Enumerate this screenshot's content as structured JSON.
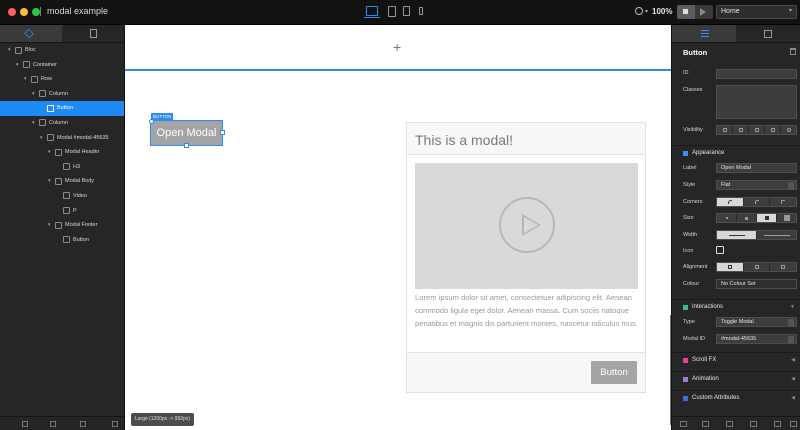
{
  "titlebar": {
    "app_title": "modal example",
    "zoom": "100%",
    "page_select": "Home"
  },
  "left_panel": {
    "tabs": [
      "layers-icon",
      "pages-icon"
    ],
    "tree": [
      {
        "label": "Bloc",
        "depth": 0,
        "expanded": true,
        "selected": false
      },
      {
        "label": "Container",
        "depth": 1,
        "expanded": true,
        "selected": false
      },
      {
        "label": "Row",
        "depth": 2,
        "expanded": true,
        "selected": false
      },
      {
        "label": "Column",
        "depth": 3,
        "expanded": true,
        "selected": false
      },
      {
        "label": "Button",
        "depth": 4,
        "expanded": false,
        "selected": true
      },
      {
        "label": "Column",
        "depth": 3,
        "expanded": true,
        "selected": false
      },
      {
        "label": "Modal #modal-45635",
        "depth": 4,
        "expanded": true,
        "selected": false
      },
      {
        "label": "Modal Header",
        "depth": 5,
        "expanded": true,
        "selected": false
      },
      {
        "label": "H3",
        "depth": 6,
        "expanded": false,
        "selected": false
      },
      {
        "label": "Modal Body",
        "depth": 5,
        "expanded": true,
        "selected": false
      },
      {
        "label": "Video",
        "depth": 6,
        "expanded": false,
        "selected": false
      },
      {
        "label": "P",
        "depth": 6,
        "expanded": false,
        "selected": false
      },
      {
        "label": "Modal Footer",
        "depth": 5,
        "expanded": true,
        "selected": false
      },
      {
        "label": "Button",
        "depth": 6,
        "expanded": false,
        "selected": false
      }
    ]
  },
  "canvas": {
    "selection_tag": "BUTTON",
    "open_modal_label": "Open Modal",
    "modal_title": "This is a modal!",
    "modal_body": "Lorem ipsum dolor sit amet, consectetuer adipiscing elit. Aenean commodo ligula eget dolor. Aenean massa. Cum sociis natoque penatibus et magnis dis parturient montes, nascetur ridiculus mus.",
    "footer_button": "Button",
    "breakpoint": "Large (1200px -> 992px)"
  },
  "right_panel": {
    "header": "Button",
    "id_label": "ID",
    "id_value": "",
    "classes_label": "Classes",
    "classes_value": "",
    "visibility_label": "Visibility",
    "appearance_label": "Appearance",
    "appearance_color": "#3a8ff5",
    "label_label": "Label",
    "label_value": "Open Modal",
    "style_label": "Style",
    "style_value": "Flat",
    "corners_label": "Corners",
    "size_label": "Size",
    "width_label": "Width",
    "icon_label": "Icon",
    "alignment_label": "Alignment",
    "colour_label": "Colour",
    "colour_value": "No Colour Set",
    "interactions_label": "Interactions",
    "interactions_color": "#2ec27e",
    "type_label": "Type",
    "type_value": "Toggle Modal",
    "modal_id_label": "Modal ID",
    "modal_id_value": "#modal-45635",
    "scroll_fx_label": "Scroll FX",
    "scroll_fx_color": "#e84393",
    "animation_label": "Animation",
    "animation_color": "#a07cd6",
    "custom_attr_label": "Custom Attributes",
    "custom_attr_color": "#3a6fd6"
  }
}
